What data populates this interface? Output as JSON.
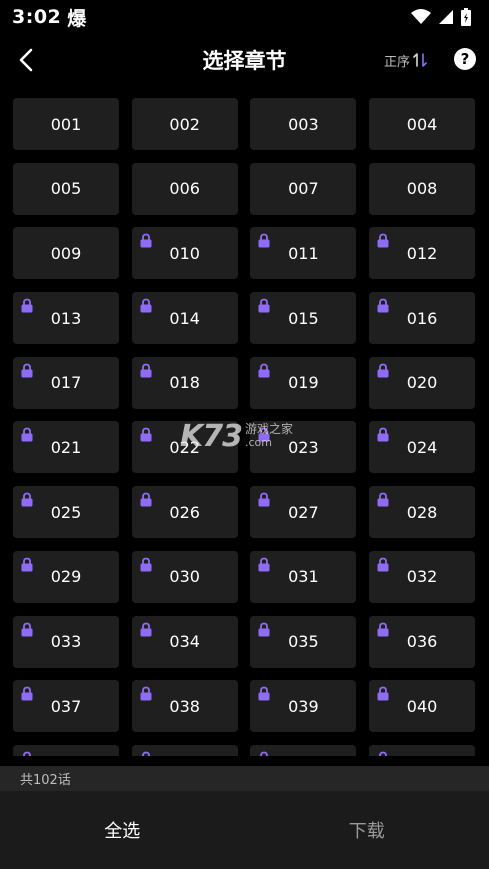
{
  "status_bar": {
    "time": "3:02",
    "notification_glyph": "爆"
  },
  "header": {
    "title": "选择章节",
    "sort_label": "正序"
  },
  "chapters": [
    {
      "label": "001",
      "locked": false
    },
    {
      "label": "002",
      "locked": false
    },
    {
      "label": "003",
      "locked": false
    },
    {
      "label": "004",
      "locked": false
    },
    {
      "label": "005",
      "locked": false
    },
    {
      "label": "006",
      "locked": false
    },
    {
      "label": "007",
      "locked": false
    },
    {
      "label": "008",
      "locked": false
    },
    {
      "label": "009",
      "locked": false
    },
    {
      "label": "010",
      "locked": true
    },
    {
      "label": "011",
      "locked": true
    },
    {
      "label": "012",
      "locked": true
    },
    {
      "label": "013",
      "locked": true
    },
    {
      "label": "014",
      "locked": true
    },
    {
      "label": "015",
      "locked": true
    },
    {
      "label": "016",
      "locked": true
    },
    {
      "label": "017",
      "locked": true
    },
    {
      "label": "018",
      "locked": true
    },
    {
      "label": "019",
      "locked": true
    },
    {
      "label": "020",
      "locked": true
    },
    {
      "label": "021",
      "locked": true
    },
    {
      "label": "022",
      "locked": true
    },
    {
      "label": "023",
      "locked": true
    },
    {
      "label": "024",
      "locked": true
    },
    {
      "label": "025",
      "locked": true
    },
    {
      "label": "026",
      "locked": true
    },
    {
      "label": "027",
      "locked": true
    },
    {
      "label": "028",
      "locked": true
    },
    {
      "label": "029",
      "locked": true
    },
    {
      "label": "030",
      "locked": true
    },
    {
      "label": "031",
      "locked": true
    },
    {
      "label": "032",
      "locked": true
    },
    {
      "label": "033",
      "locked": true
    },
    {
      "label": "034",
      "locked": true
    },
    {
      "label": "035",
      "locked": true
    },
    {
      "label": "036",
      "locked": true
    },
    {
      "label": "037",
      "locked": true
    },
    {
      "label": "038",
      "locked": true
    },
    {
      "label": "039",
      "locked": true
    },
    {
      "label": "040",
      "locked": true
    },
    {
      "label": "",
      "locked": true
    },
    {
      "label": "",
      "locked": true
    },
    {
      "label": "",
      "locked": true
    },
    {
      "label": "",
      "locked": true
    }
  ],
  "watermark": {
    "logo": "K73",
    "cn": "游戏之家",
    "com": ".com"
  },
  "footer": {
    "count_text": "共102话",
    "select_all_label": "全选",
    "download_label": "下载"
  },
  "colors": {
    "background": "#000000",
    "cell_background": "#1f1f1f",
    "lock_icon": "#8f6cf5",
    "sort_arrow_accent": "#8f6cf5",
    "count_bar": "#262626",
    "action_bar": "#1b1b1b"
  },
  "icons": {
    "back": "chevron-left-icon",
    "sort": "sort-arrows-icon",
    "help": "question-circle-icon",
    "lock": "lock-icon",
    "wifi": "wifi-icon",
    "signal": "signal-icon",
    "battery": "battery-icon"
  }
}
